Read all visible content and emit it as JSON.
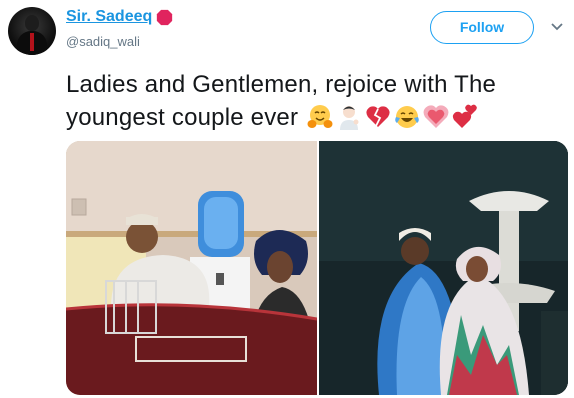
{
  "tweet": {
    "author_name": "Sir. Sadeeq",
    "author_handle": "@sadiq_wali",
    "follow_label": "Follow",
    "text": "Ladies and Gentlemen, rejoice with The youngest couple ever",
    "emojis": [
      "hugging-face",
      "man-tipping-hand",
      "broken-heart",
      "face-with-tears-of-joy",
      "growing-heart",
      "two-hearts"
    ]
  },
  "colors": {
    "accent": "#1da1f2",
    "name_link": "#1b95e0",
    "text": "#14171a",
    "secondary": "#657786",
    "badge": "#e0245e"
  }
}
